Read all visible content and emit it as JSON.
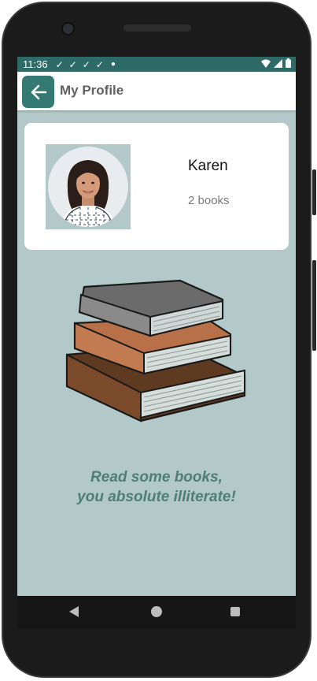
{
  "status_bar": {
    "time": "11:36",
    "notification_icons": [
      "check-notification-icon",
      "check-notification-icon",
      "check-notification-icon",
      "check-notification-icon"
    ],
    "color": "#2f6b66"
  },
  "app_bar": {
    "title": "My Profile",
    "accent_color": "#357a72"
  },
  "profile": {
    "name": "Karen",
    "books_count_text": "2 books"
  },
  "illustration": {
    "icon": "book-stack-icon"
  },
  "tagline": {
    "line1": "Read some books,",
    "line2": "you absolute illiterate!"
  },
  "colors": {
    "background": "#b3c8c8",
    "tagline": "#4f7e79"
  }
}
